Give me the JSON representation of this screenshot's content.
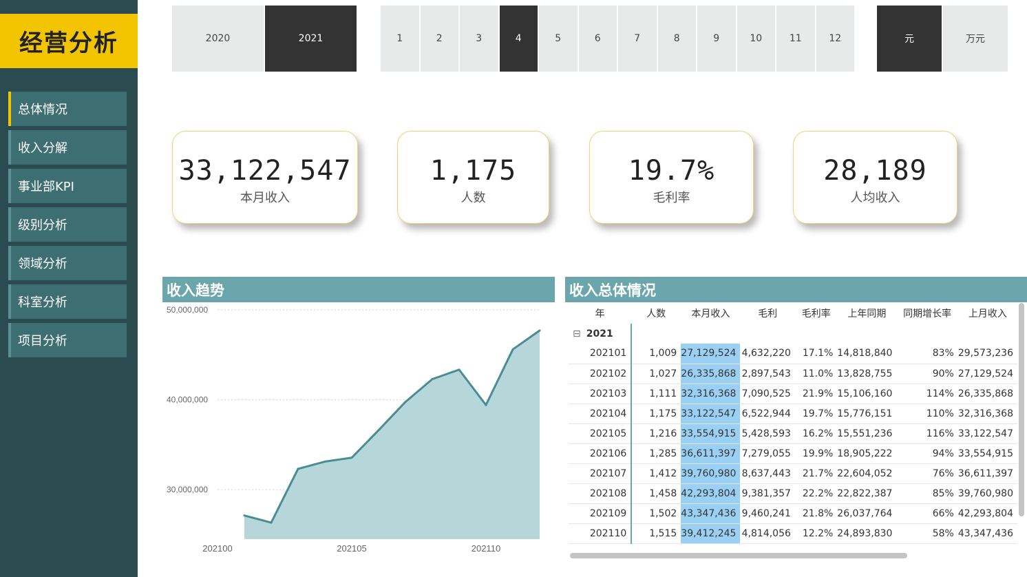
{
  "app_title": "经营分析",
  "nav": [
    "总体情况",
    "收入分解",
    "事业部KPI",
    "级别分析",
    "领域分析",
    "科室分析",
    "项目分析"
  ],
  "years": [
    "2020",
    "2021"
  ],
  "months": [
    "1",
    "2",
    "3",
    "4",
    "5",
    "6",
    "7",
    "8",
    "9",
    "10",
    "11",
    "12"
  ],
  "units": [
    "元",
    "万元"
  ],
  "selected": {
    "year": "2021",
    "month": "4",
    "unit": "元"
  },
  "kpis": [
    {
      "value": "33,122,547",
      "label": "本月收入"
    },
    {
      "value": "1,175",
      "label": "人数"
    },
    {
      "value": "19.7%",
      "label": "毛利率"
    },
    {
      "value": "28,189",
      "label": "人均收入"
    }
  ],
  "trend_title": "收入趋势",
  "table_title": "收入总体情况",
  "chart_data": {
    "type": "area",
    "title": "收入趋势",
    "x": [
      "202101",
      "202102",
      "202103",
      "202104",
      "202105",
      "202106",
      "202107",
      "202108",
      "202109",
      "202110",
      "202111",
      "202112"
    ],
    "tick_labels": [
      "202100",
      "202105",
      "202110"
    ],
    "values": [
      27129524,
      26335868,
      32316368,
      33122547,
      33554915,
      36611397,
      39760980,
      42293804,
      43347436,
      39412245,
      45600000,
      47700000
    ],
    "yticks": [
      "50,000,000",
      "40,000,000",
      "30,000,000"
    ],
    "ylim": [
      24500000,
      50000000
    ],
    "xlim": [
      202100,
      202112
    ],
    "grid": true,
    "colors": {
      "line": "#4a8c93",
      "fill": "#b6d6d9"
    }
  },
  "table": {
    "columns": [
      "年",
      "人数",
      "本月收入",
      "毛利",
      "毛利率",
      "上年同期",
      "同期增长率",
      "上月收入"
    ],
    "group": "2021",
    "group_toggle": "⊟",
    "rows": [
      [
        "202101",
        "1,009",
        "27,129,524",
        "4,632,220",
        "17.1%",
        "14,818,840",
        "83%",
        "29,573,236"
      ],
      [
        "202102",
        "1,027",
        "26,335,868",
        "2,897,543",
        "11.0%",
        "13,828,755",
        "90%",
        "27,129,524"
      ],
      [
        "202103",
        "1,111",
        "32,316,368",
        "7,090,525",
        "21.9%",
        "15,106,160",
        "114%",
        "26,335,868"
      ],
      [
        "202104",
        "1,175",
        "33,122,547",
        "6,522,944",
        "19.7%",
        "15,776,151",
        "110%",
        "32,316,368"
      ],
      [
        "202105",
        "1,216",
        "33,554,915",
        "5,428,593",
        "16.2%",
        "15,551,236",
        "116%",
        "33,122,547"
      ],
      [
        "202106",
        "1,285",
        "36,611,397",
        "7,279,055",
        "19.9%",
        "18,905,222",
        "94%",
        "33,554,915"
      ],
      [
        "202107",
        "1,412",
        "39,760,980",
        "8,637,443",
        "21.7%",
        "22,604,052",
        "76%",
        "36,611,397"
      ],
      [
        "202108",
        "1,458",
        "42,293,804",
        "9,381,357",
        "22.2%",
        "22,822,387",
        "85%",
        "39,760,980"
      ],
      [
        "202109",
        "1,502",
        "43,347,436",
        "9,460,241",
        "21.8%",
        "26,037,764",
        "66%",
        "42,293,804"
      ],
      [
        "202110",
        "1,515",
        "39,412,245",
        "4,814,056",
        "12.2%",
        "24,893,830",
        "58%",
        "43,347,436"
      ]
    ]
  }
}
